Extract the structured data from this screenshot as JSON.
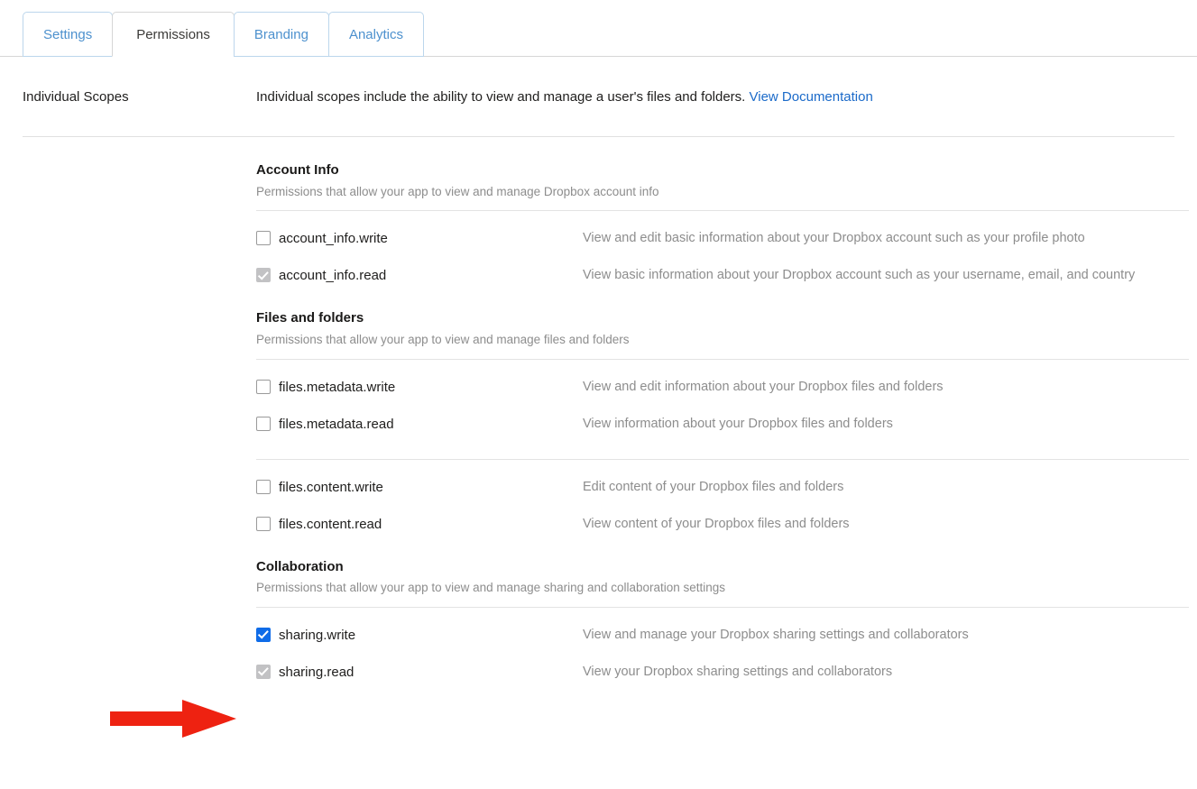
{
  "tabs": [
    {
      "label": "Settings",
      "active": false
    },
    {
      "label": "Permissions",
      "active": true
    },
    {
      "label": "Branding",
      "active": false
    },
    {
      "label": "Analytics",
      "active": false
    }
  ],
  "scopes_header": {
    "label": "Individual Scopes",
    "description": "Individual scopes include the ability to view and manage a user's files and folders.",
    "link_label": "View Documentation"
  },
  "groups": [
    {
      "title": "Account Info",
      "subtitle": "Permissions that allow your app to view and manage Dropbox account info",
      "scopes": [
        {
          "name": "account_info.write",
          "description": "View and edit basic information about your Dropbox account such as your profile photo",
          "state": "unchecked"
        },
        {
          "name": "account_info.read",
          "description": "View basic information about your Dropbox account such as your username, email, and country",
          "state": "disabled-checked"
        }
      ]
    },
    {
      "title": "Files and folders",
      "subtitle": "Permissions that allow your app to view and manage files and folders",
      "scopes": [
        {
          "name": "files.metadata.write",
          "description": "View and edit information about your Dropbox files and folders",
          "state": "unchecked"
        },
        {
          "name": "files.metadata.read",
          "description": "View information about your Dropbox files and folders",
          "state": "unchecked"
        }
      ],
      "extra_scopes": [
        {
          "name": "files.content.write",
          "description": "Edit content of your Dropbox files and folders",
          "state": "unchecked"
        },
        {
          "name": "files.content.read",
          "description": "View content of your Dropbox files and folders",
          "state": "unchecked"
        }
      ]
    },
    {
      "title": "Collaboration",
      "subtitle": "Permissions that allow your app to view and manage sharing and collaboration settings",
      "scopes": [
        {
          "name": "sharing.write",
          "description": "View and manage your Dropbox sharing settings and collaborators",
          "state": "checked"
        },
        {
          "name": "sharing.read",
          "description": "View your Dropbox sharing settings and collaborators",
          "state": "disabled-checked"
        }
      ]
    }
  ],
  "annotation": {
    "type": "red-arrow",
    "points_to": "sharing.write",
    "color": "#ee2211"
  },
  "colors": {
    "tab_link": "#4d91ce",
    "doc_link": "#1b6ac9",
    "checkbox_checked": "#0f6ce8",
    "checkbox_disabled": "#c2c2c4",
    "annotation_red": "#ee2211"
  }
}
